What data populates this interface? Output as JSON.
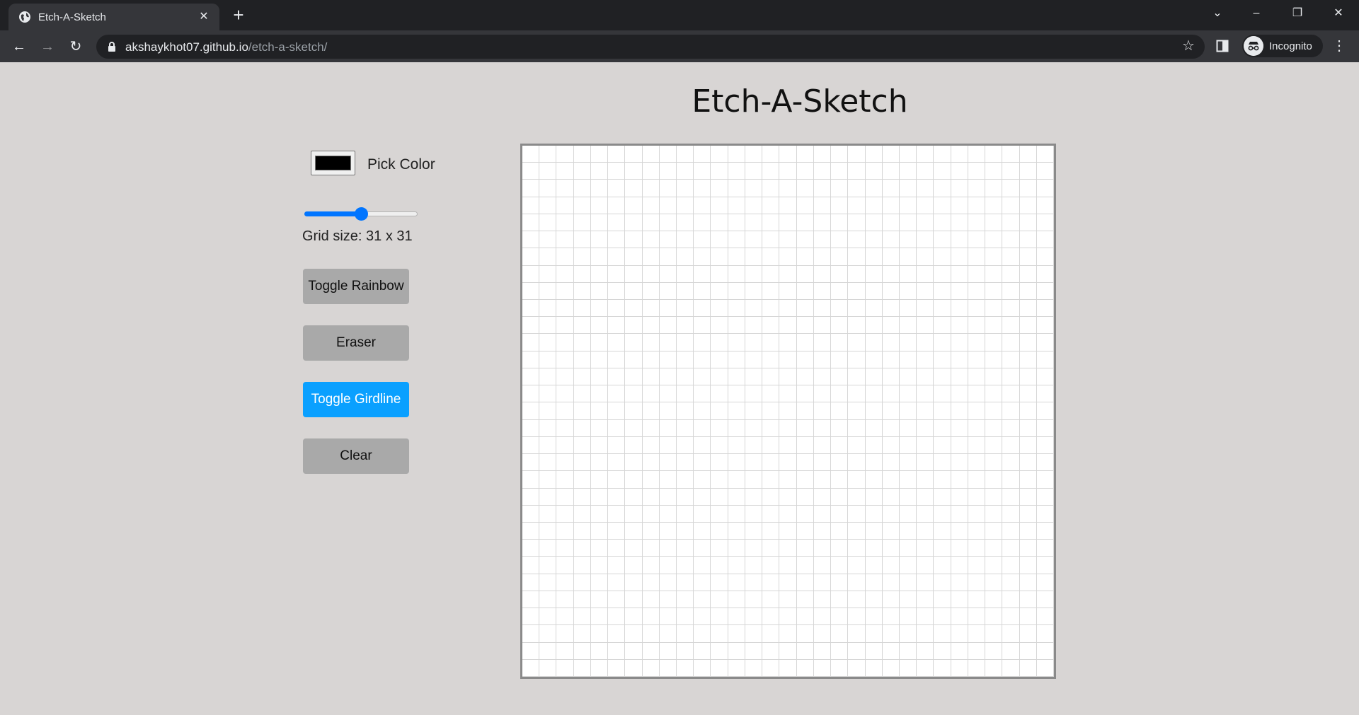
{
  "browser": {
    "tab_title": "Etch-A-Sketch",
    "url_domain": "akshaykhot07.github.io",
    "url_path": "/etch-a-sketch/",
    "profile_label": "Incognito",
    "icons": [
      "globe-icon",
      "close-icon",
      "plus-icon",
      "chevron-down-icon",
      "minimize-icon",
      "restore-icon",
      "window-close-icon",
      "back-icon",
      "forward-icon",
      "reload-icon",
      "lock-icon",
      "star-icon",
      "side-panel-icon",
      "incognito-icon",
      "kebab-menu-icon"
    ]
  },
  "page": {
    "title": "Etch-A-Sketch",
    "pick_color_label": "Pick Color",
    "picked_color": "#000000",
    "grid_size_text": "Grid size: 31 x 31",
    "grid_size": 31,
    "slider_fraction": 0.5,
    "buttons": {
      "rainbow": "Toggle Rainbow",
      "eraser": "Eraser",
      "gridline": "Toggle Girdline",
      "clear": "Clear"
    },
    "active_button": "gridline",
    "colors": {
      "accent": "#0aa0ff",
      "button": "#a9a9a9",
      "background": "#d8d5d4"
    }
  }
}
